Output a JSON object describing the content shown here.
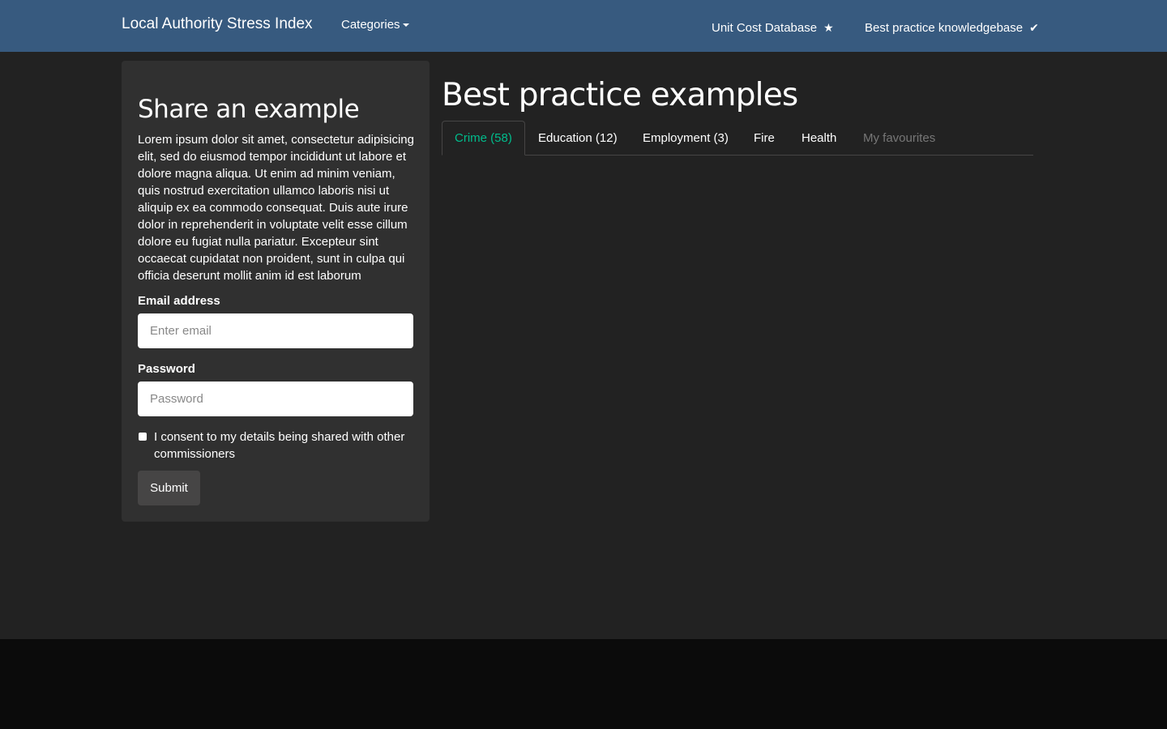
{
  "navbar": {
    "brand": "Local Authority Stress Index",
    "categories_label": "Categories",
    "links": [
      {
        "label": "Unit Cost Database",
        "icon": "★"
      },
      {
        "label": "Best practice knowledgebase",
        "icon": "✔"
      }
    ]
  },
  "share": {
    "title": "Share an example",
    "body": "Lorem ipsum dolor sit amet, consectetur adipisicing elit, sed do eiusmod tempor incididunt ut labore et dolore magna aliqua. Ut enim ad minim veniam, quis nostrud exercitation ullamco laboris nisi ut aliquip ex ea commodo consequat. Duis aute irure dolor in reprehenderit in voluptate velit esse cillum dolore eu fugiat nulla pariatur. Excepteur sint occaecat cupidatat non proident, sunt in culpa qui officia deserunt mollit anim id est laborum",
    "email_label": "Email address",
    "email_placeholder": "Enter email",
    "email_value": "",
    "password_label": "Password",
    "password_placeholder": "Password",
    "password_value": "",
    "consent_label": "I consent to my details being shared with other commissioners",
    "consent_checked": false,
    "submit_label": "Submit"
  },
  "main": {
    "title": "Best practice examples",
    "tabs": [
      {
        "label": "Crime (58)",
        "state": "active"
      },
      {
        "label": "Education (12)",
        "state": "normal"
      },
      {
        "label": "Employment (3)",
        "state": "normal"
      },
      {
        "label": "Fire",
        "state": "normal"
      },
      {
        "label": "Health",
        "state": "normal"
      },
      {
        "label": "My favourites",
        "state": "disabled"
      }
    ]
  },
  "colors": {
    "navbar": "#375a7f",
    "background": "#222222",
    "panel": "#303030",
    "accent": "#00bc8c",
    "footer": "#0b0b0b",
    "button": "#464545"
  }
}
